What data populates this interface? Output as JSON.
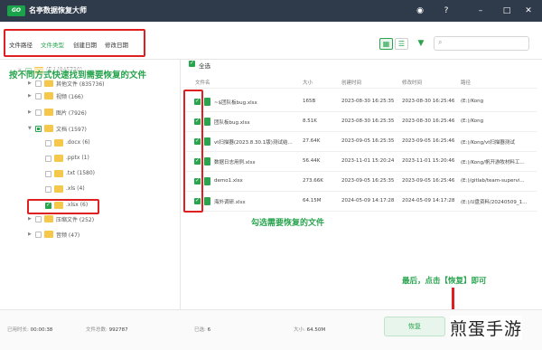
{
  "app": {
    "logo_text": "GO",
    "title": "名亭数据恢复大师"
  },
  "titlebar_icons": [
    "user-circle-icon",
    "help-icon",
    "minimize-icon",
    "maximize-icon",
    "close-icon"
  ],
  "tabs": [
    {
      "label": "文件路径",
      "active": false
    },
    {
      "label": "文件类型",
      "active": true
    },
    {
      "label": "创建日期",
      "active": false
    },
    {
      "label": "修改日期",
      "active": false
    }
  ],
  "toolbar": {
    "view_grid_icon": "grid-view-icon",
    "view_list_icon": "list-view-icon",
    "filter_icon": "filter-icon",
    "search_placeholder": ""
  },
  "tree": [
    {
      "label": "(E:) (845730)",
      "depth": 0,
      "check": "partial",
      "expanded": true
    },
    {
      "label": "其他文件 (835736)",
      "depth": 1,
      "check": "off",
      "expanded": false
    },
    {
      "label": "视频 (166)",
      "depth": 1,
      "check": "off",
      "expanded": false
    },
    {
      "label": "图片 (7926)",
      "depth": 1,
      "check": "off",
      "expanded": false
    },
    {
      "label": "文档 (1597)",
      "depth": 1,
      "check": "partial",
      "expanded": true
    },
    {
      "label": ".docx (6)",
      "depth": 2,
      "check": "off",
      "expanded": false
    },
    {
      "label": ".pptx (1)",
      "depth": 2,
      "check": "off",
      "expanded": false
    },
    {
      "label": ".txt (1580)",
      "depth": 2,
      "check": "off",
      "expanded": false
    },
    {
      "label": ".xls (4)",
      "depth": 2,
      "check": "off",
      "expanded": false
    },
    {
      "label": ".xlsx (6)",
      "depth": 2,
      "check": "on",
      "expanded": false
    },
    {
      "label": "压缩文件 (252)",
      "depth": 1,
      "check": "off",
      "expanded": false
    },
    {
      "label": "音频 (47)",
      "depth": 1,
      "check": "off",
      "expanded": false
    }
  ],
  "list": {
    "select_all": "全选",
    "columns": [
      "文件名",
      "大小",
      "创建时间",
      "修改时间",
      "路径"
    ],
    "rows": [
      {
        "name": "~$团队板bug.xlsx",
        "size": "165B",
        "created": "2023-08-30 16:25:35",
        "modified": "2023-08-30 16:25:46",
        "path": "(E:)/Kong"
      },
      {
        "name": "团队板bug.xlsx",
        "size": "8.51K",
        "created": "2023-08-30 16:25:35",
        "modified": "2023-08-30 16:25:46",
        "path": "(E:)/Kong"
      },
      {
        "name": "vt扫描器(2023.8.30.1版)测试结...",
        "size": "27.64K",
        "created": "2023-09-05 16:25:35",
        "modified": "2023-09-05 16:25:46",
        "path": "(E:)/Kong/vt扫描器测试"
      },
      {
        "name": "数据日志用例.xlsx",
        "size": "56.44K",
        "created": "2023-11-01 15:20:24",
        "modified": "2023-11-01 15:20:46",
        "path": "(E:)/Kong/帆开游牧材料工..."
      },
      {
        "name": "demo1.xlsx",
        "size": "273.66K",
        "created": "2023-09-05 16:25:35",
        "modified": "2023-09-05 16:25:46",
        "path": "(E:)/gitlab/team-supervi..."
      },
      {
        "name": "海外调研.xlsx",
        "size": "64.15M",
        "created": "2024-05-09 14:17:28",
        "modified": "2024-05-09 14:17:28",
        "path": "(E:)/U盘资料/20240509_1..."
      }
    ]
  },
  "annotations": {
    "left": "按不同方式快速找到需要恢复的文件",
    "middle": "勾选需要恢复的文件",
    "recover": "最后，点击【恢复】即可"
  },
  "status": {
    "time_label": "已用时长:",
    "time_value": "00:00:38",
    "count_label": "文件总数:",
    "count_value": "992787",
    "selected_label": "已选:",
    "selected_value": "6",
    "size_label": "大小:",
    "size_value": "64.50M"
  },
  "recover_button": "恢复",
  "watermark": "煎蛋手游",
  "colors": {
    "accent": "#2aa44f",
    "highlight": "#e02020",
    "titlebar": "#2f3b4a"
  }
}
